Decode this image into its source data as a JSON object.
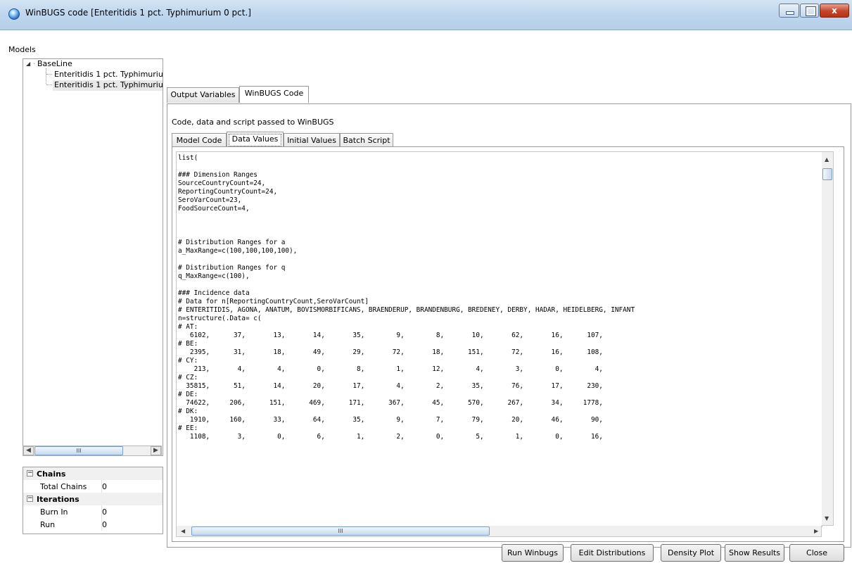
{
  "window": {
    "title": "WinBUGS code [Enteritidis 1 pct. Typhimurium 0 pct.]",
    "min_glyph": "",
    "max_glyph": "",
    "close_glyph": "x"
  },
  "models": {
    "label": "Models",
    "tree": {
      "root": "BaseLine",
      "children": [
        "Enteritidis 1 pct. Typhimuriu",
        "Enteritidis 1 pct. Typhimuriu"
      ],
      "selected_index": 1
    }
  },
  "properties": {
    "groups": [
      {
        "name": "Chains",
        "rows": [
          {
            "key": "Total Chains",
            "value": "0"
          }
        ]
      },
      {
        "name": "Iterations",
        "rows": [
          {
            "key": "Burn In",
            "value": "0"
          },
          {
            "key": "Run",
            "value": "0"
          }
        ]
      }
    ]
  },
  "tabs": {
    "outer": [
      "Output Variables",
      "WinBUGS Code"
    ],
    "outer_active": "WinBUGS Code",
    "description": "Code, data and script passed to WinBUGS",
    "inner": [
      "Model Code",
      "Data Values",
      "Initial Values",
      "Batch Script"
    ],
    "inner_active": "Data Values"
  },
  "editor": {
    "lines": [
      "list(",
      "",
      "### Dimension Ranges",
      "SourceCountryCount=24,",
      "ReportingCountryCount=24,",
      "SeroVarCount=23,",
      "FoodSourceCount=4,",
      "",
      "",
      "",
      "# Distribution Ranges for a",
      "a_MaxRange=c(100,100,100,100),",
      "",
      "# Distribution Ranges for q",
      "q_MaxRange=c(100),",
      "",
      "### Incidence data",
      "# Data for n[ReportingCountryCount,SeroVarCount]",
      "# ENTERITIDIS, AGONA, ANATUM, BOVISMORBIFICANS, BRAENDERUP, BRANDENBURG, BREDENEY, DERBY, HADAR, HEIDELBERG, INFANT",
      "n=structure(.Data= c(",
      "# AT:",
      "   6102,      37,       13,       14,       35,        9,        8,       10,       62,       16,      107,",
      "# BE:",
      "   2395,      31,       18,       49,       29,       72,       18,      151,       72,       16,      108,",
      "# CY:",
      "    213,       4,        4,        0,        8,        1,       12,        4,        3,        0,        4,",
      "# CZ:",
      "  35815,      51,       14,       20,       17,        4,        2,       35,       76,       17,      230,",
      "# DE:",
      "  74622,     206,      151,      469,      171,      367,       45,      570,      267,       34,     1778,",
      "# DK:",
      "   1910,     160,       33,       64,       35,        9,        7,       79,       20,       46,       90,",
      "# EE:",
      "   1108,       3,        0,        6,        1,        2,        0,        5,        1,        0,       16,"
    ]
  },
  "buttons": {
    "run": "Run Winbugs",
    "edit": "Edit Distributions",
    "density": "Density Plot",
    "show": "Show Results",
    "close": "Close"
  },
  "icons": {
    "app": "winbugs-app-icon",
    "tree_expander": "triangle-down-icon",
    "scroll_left": "arrow-left-icon",
    "scroll_right": "arrow-right-icon",
    "scroll_up": "arrow-up-icon",
    "scroll_down": "arrow-down-icon",
    "group_collapse": "minus-box-icon"
  }
}
